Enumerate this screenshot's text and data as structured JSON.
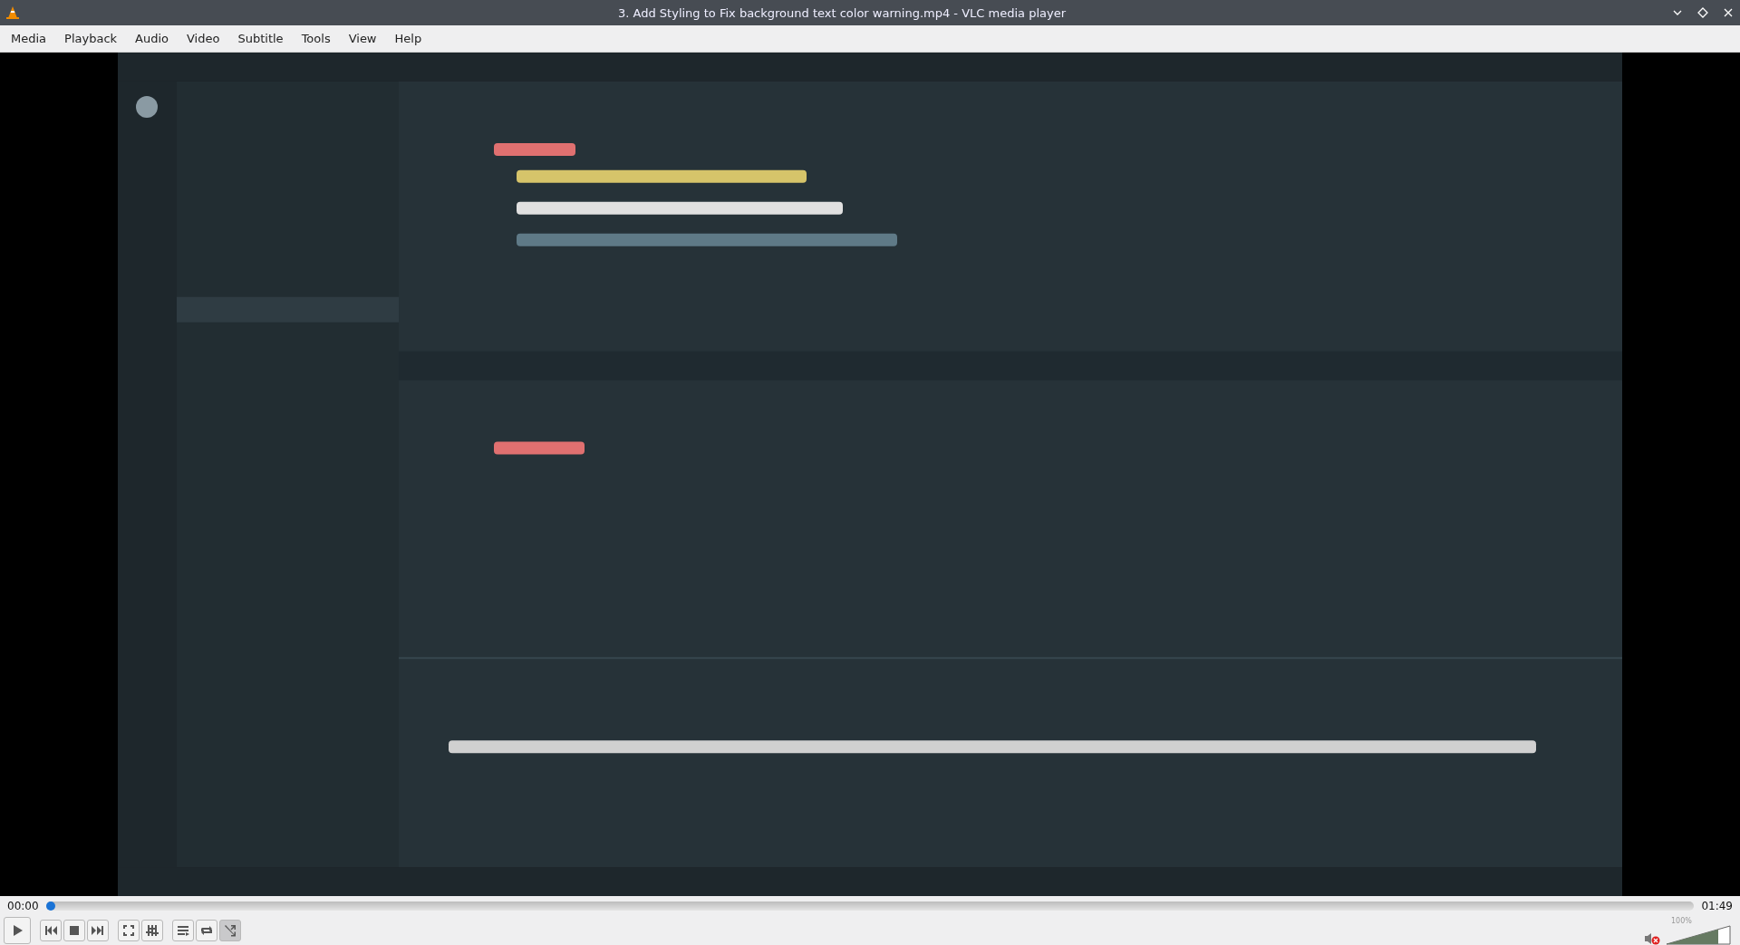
{
  "window": {
    "title": "3. Add Styling to Fix background text color warning.mp4 - VLC media player"
  },
  "menu": [
    "Media",
    "Playback",
    "Audio",
    "Video",
    "Subtitle",
    "Tools",
    "View",
    "Help"
  ],
  "seek": {
    "elapsed": "00:00",
    "total": "01:49",
    "level": 0.005
  },
  "controls": {
    "shuffle": true,
    "loop": false
  },
  "volume": {
    "muted": true,
    "level": 0.8,
    "reading": "100%"
  }
}
